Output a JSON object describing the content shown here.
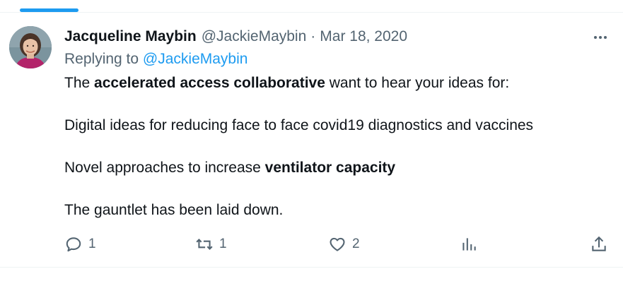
{
  "tweet": {
    "author": {
      "display_name": "Jacqueline Maybin",
      "handle": "@JackieMaybin"
    },
    "separator": "·",
    "date": "Mar 18, 2020",
    "replying_prefix": "Replying to ",
    "replying_to": "@JackieMaybin",
    "lines": {
      "l1_pre": "The ",
      "l1_bold": "accelerated access collaborative",
      "l1_post": " want to hear your ideas for:",
      "l2": "Digital ideas for reducing face to face covid19 diagnostics and vaccines",
      "l3_pre": "Novel approaches to increase ",
      "l3_bold": "ventilator capacity",
      "l4": "The gauntlet has been laid down."
    },
    "stats": {
      "replies": "1",
      "retweets": "1",
      "likes": "2"
    }
  },
  "icons": {
    "more": "more-horizontal-icon",
    "reply": "reply-icon",
    "retweet": "retweet-icon",
    "like": "heart-icon",
    "views": "analytics-icon",
    "share": "share-icon"
  },
  "colors": {
    "accent": "#1d9bf0",
    "text": "#0f1419",
    "secondary": "#536471",
    "divider": "#eff3f4"
  }
}
